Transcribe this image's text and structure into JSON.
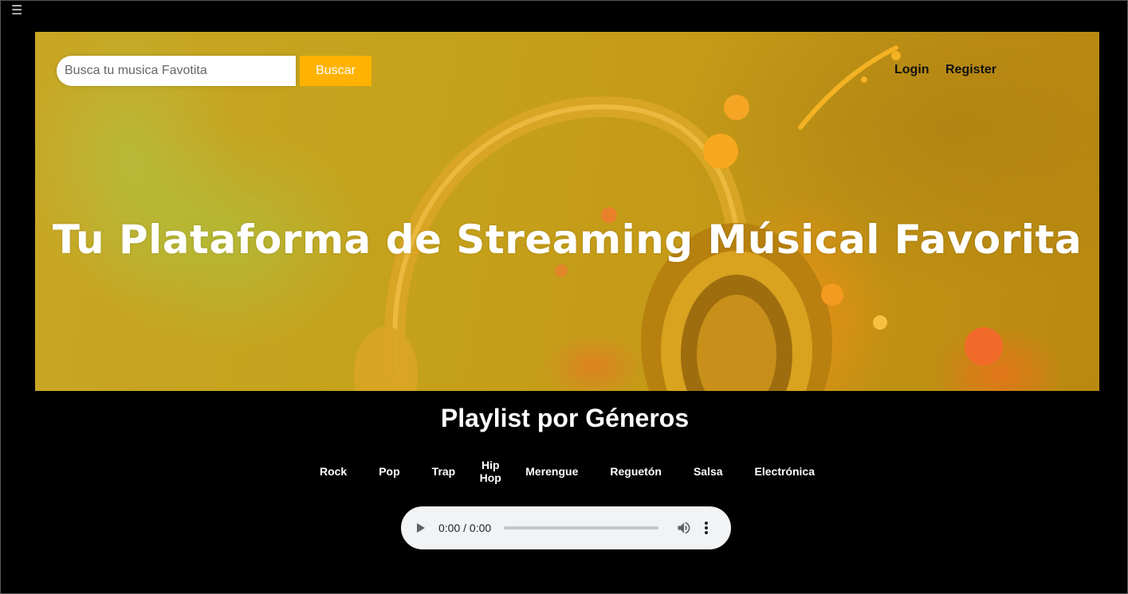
{
  "menu": {
    "icon": "hamburger-menu-icon",
    "glyph": "☰"
  },
  "header": {
    "search": {
      "placeholder": "Busca tu musica Favotita",
      "value": "",
      "icon": ""
    },
    "search_button_label": "Buscar",
    "login_label": "Login",
    "register_label": "Register"
  },
  "hero": {
    "title": "Tu Plataforma de Streaming Músical Favorita",
    "background_image": "headphones-paint-splash-image"
  },
  "genres_section": {
    "title": "Playlist por Géneros",
    "items": [
      {
        "label": "Rock"
      },
      {
        "label": "Pop"
      },
      {
        "label": "Trap"
      },
      {
        "label": "Hip Hop"
      },
      {
        "label": "Merengue"
      },
      {
        "label": "Reguetón"
      },
      {
        "label": "Salsa"
      },
      {
        "label": "Electrónica"
      }
    ]
  },
  "audio_player": {
    "time_display": "0:00 / 0:00",
    "progress": 0,
    "icons": [
      "play-icon",
      "volume-icon",
      "more-options-icon"
    ]
  },
  "colors": {
    "page_background": "#000000",
    "accent": "#ffb300",
    "hero_base": "#c5a21c",
    "player_background": "#f1f3f4"
  }
}
